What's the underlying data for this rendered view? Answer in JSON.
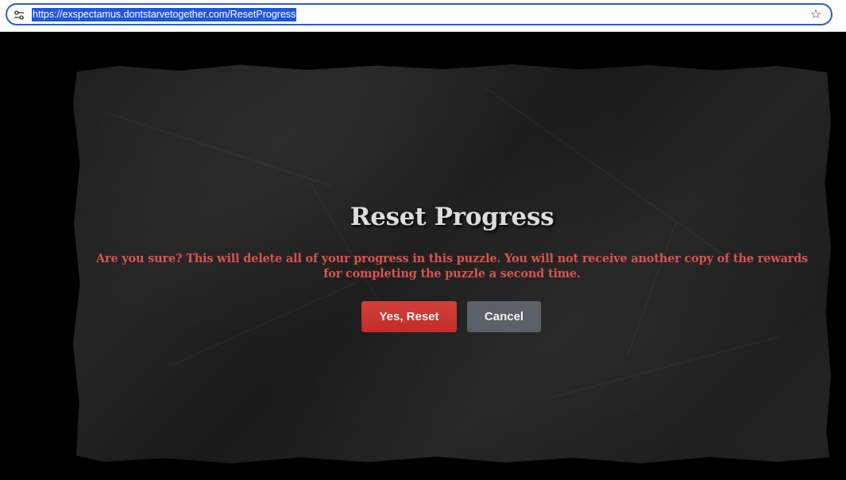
{
  "browser": {
    "url": "https://exspectamus.dontstarvetogether.com/ResetProgress",
    "site_info_icon": "tune-icon",
    "bookmark_icon": "star-icon"
  },
  "dialog": {
    "title": "Reset Progress",
    "message": "Are you sure? This will delete all of your progress in this puzzle. You will not receive another copy of the rewards for completing the puzzle a second time.",
    "confirm_label": "Yes, Reset",
    "cancel_label": "Cancel"
  },
  "colors": {
    "page_background": "#000000",
    "paper": "#1f1f1f",
    "title": "#dcdcdc",
    "message": "#d9534f",
    "confirm_button": "#c9302c",
    "cancel_button": "#5a6169",
    "address_border": "#2a5fc7",
    "url_highlight": "#1f56e0"
  }
}
